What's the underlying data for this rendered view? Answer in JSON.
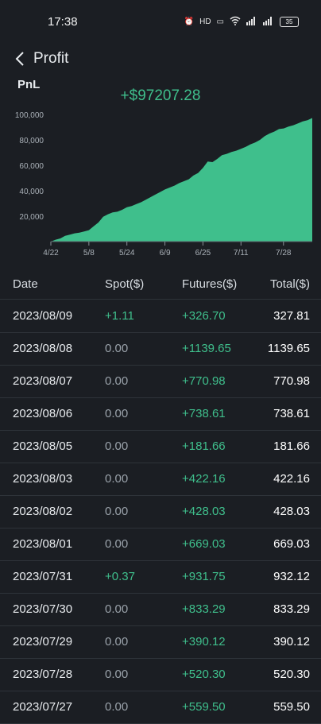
{
  "status_bar": {
    "time": "17:38",
    "icons": [
      "alarm-icon",
      "hd-icon",
      "volte-icon",
      "wifi-icon",
      "signal-icon",
      "signal-icon"
    ],
    "battery": "35"
  },
  "nav": {
    "title": "Profit"
  },
  "pnl": {
    "label": "PnL",
    "total": "+$97207.28"
  },
  "colors": {
    "accent": "#3fbf8c",
    "background": "#1b1e23",
    "divider": "#2e3339"
  },
  "chart_data": {
    "type": "area",
    "x": [
      "4/22",
      "4/24",
      "4/26",
      "4/28",
      "4/30",
      "5/2",
      "5/4",
      "5/6",
      "5/8",
      "5/10",
      "5/12",
      "5/14",
      "5/16",
      "5/18",
      "5/20",
      "5/22",
      "5/24",
      "5/26",
      "5/28",
      "5/30",
      "6/1",
      "6/3",
      "6/5",
      "6/7",
      "6/9",
      "6/11",
      "6/13",
      "6/15",
      "6/17",
      "6/19",
      "6/21",
      "6/23",
      "6/25",
      "6/27",
      "6/29",
      "7/1",
      "7/3",
      "7/5",
      "7/7",
      "7/9",
      "7/11",
      "7/13",
      "7/15",
      "7/17",
      "7/19",
      "7/21",
      "7/23",
      "7/25",
      "7/27",
      "7/29",
      "7/31",
      "8/2",
      "8/4",
      "8/6",
      "8/8",
      "8/9"
    ],
    "values": [
      0,
      1500,
      2500,
      4500,
      5500,
      6500,
      7000,
      8000,
      9000,
      12000,
      15000,
      19500,
      21500,
      23000,
      23500,
      25000,
      27000,
      28000,
      29500,
      31000,
      33000,
      35000,
      37000,
      39000,
      41000,
      42500,
      44000,
      46000,
      47500,
      49000,
      52000,
      54000,
      58000,
      63000,
      62500,
      65000,
      68000,
      69000,
      70500,
      71500,
      73000,
      74500,
      76500,
      78000,
      80000,
      83000,
      85000,
      86500,
      88500,
      89000,
      90500,
      91500,
      93000,
      94500,
      95500,
      97207.28
    ],
    "xticks": [
      "4/22",
      "5/8",
      "5/24",
      "6/9",
      "6/25",
      "7/11",
      "7/28"
    ],
    "yticks": [
      "20,000",
      "40,000",
      "60,000",
      "80,000",
      "100,000"
    ],
    "ylim": [
      0,
      100000
    ]
  },
  "table": {
    "headers": {
      "date": "Date",
      "spot": "Spot($)",
      "futures": "Futures($)",
      "total": "Total($)"
    },
    "rows": [
      {
        "date": "2023/08/09",
        "spot": "+1.11",
        "futures": "+326.70",
        "total": "327.81"
      },
      {
        "date": "2023/08/08",
        "spot": "0.00",
        "futures": "+1139.65",
        "total": "1139.65"
      },
      {
        "date": "2023/08/07",
        "spot": "0.00",
        "futures": "+770.98",
        "total": "770.98"
      },
      {
        "date": "2023/08/06",
        "spot": "0.00",
        "futures": "+738.61",
        "total": "738.61"
      },
      {
        "date": "2023/08/05",
        "spot": "0.00",
        "futures": "+181.66",
        "total": "181.66"
      },
      {
        "date": "2023/08/03",
        "spot": "0.00",
        "futures": "+422.16",
        "total": "422.16"
      },
      {
        "date": "2023/08/02",
        "spot": "0.00",
        "futures": "+428.03",
        "total": "428.03"
      },
      {
        "date": "2023/08/01",
        "spot": "0.00",
        "futures": "+669.03",
        "total": "669.03"
      },
      {
        "date": "2023/07/31",
        "spot": "+0.37",
        "futures": "+931.75",
        "total": "932.12"
      },
      {
        "date": "2023/07/30",
        "spot": "0.00",
        "futures": "+833.29",
        "total": "833.29"
      },
      {
        "date": "2023/07/29",
        "spot": "0.00",
        "futures": "+390.12",
        "total": "390.12"
      },
      {
        "date": "2023/07/28",
        "spot": "0.00",
        "futures": "+520.30",
        "total": "520.30"
      },
      {
        "date": "2023/07/27",
        "spot": "0.00",
        "futures": "+559.50",
        "total": "559.50"
      }
    ]
  }
}
